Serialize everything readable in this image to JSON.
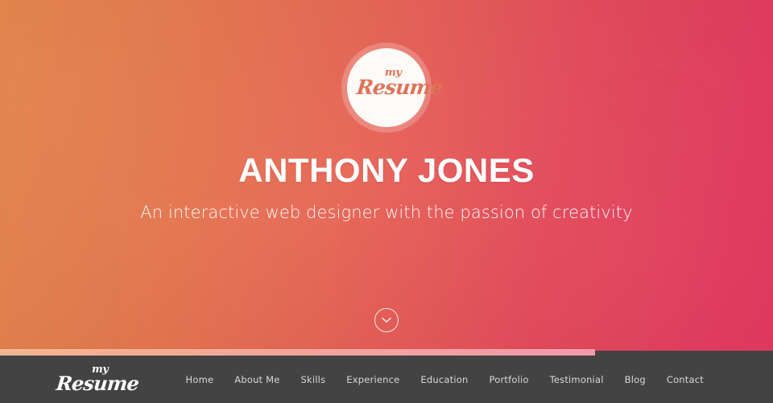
{
  "hero": {
    "logo": {
      "top_text": "my",
      "bottom_text": "Resume",
      "name": "my-resume-logo"
    },
    "title": "ANTHONY JONES",
    "subtitle": "An interactive web designer with the passion of creativity",
    "scroll_icon": "chevron-down-icon",
    "gradient_start": "#ef8c4e",
    "gradient_end": "#f53764"
  },
  "progress": {
    "percent": 77,
    "fill_color": "#ffb4a0"
  },
  "footer": {
    "background_color": "#434343",
    "logo": {
      "top_text": "my",
      "bottom_text": "Resume"
    },
    "nav": [
      {
        "label": "Home"
      },
      {
        "label": "About Me"
      },
      {
        "label": "Skills"
      },
      {
        "label": "Experience"
      },
      {
        "label": "Education"
      },
      {
        "label": "Portfolio"
      },
      {
        "label": "Testimonial"
      },
      {
        "label": "Blog"
      },
      {
        "label": "Contact"
      }
    ]
  }
}
